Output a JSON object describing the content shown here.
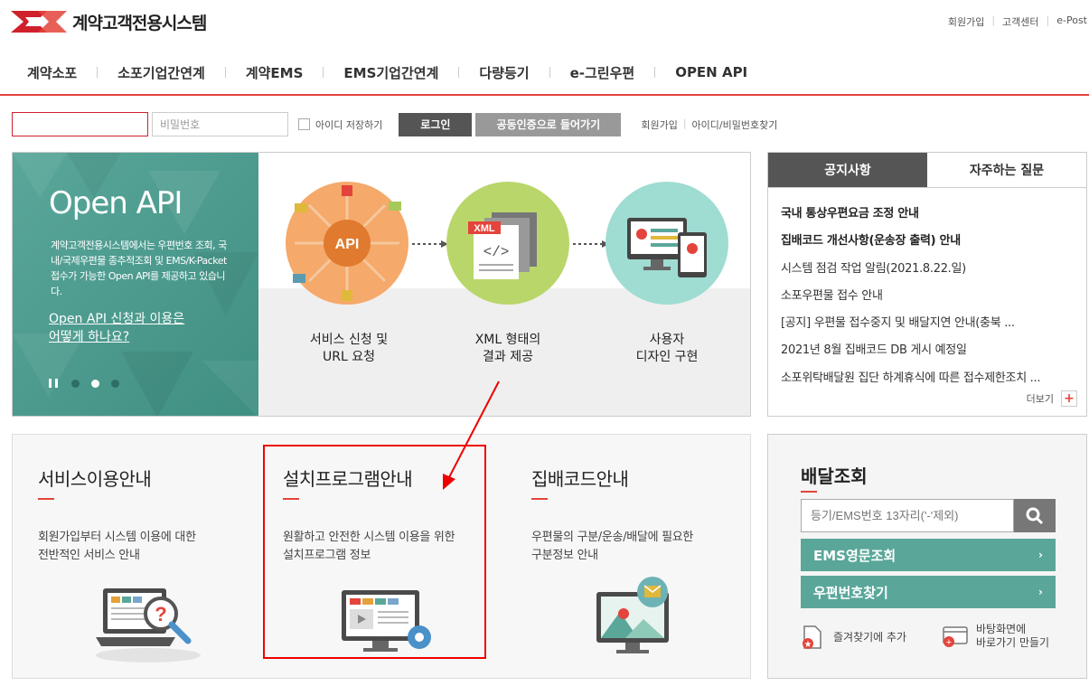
{
  "header": {
    "site_title": "계약고객전용시스템",
    "util_links": [
      "회원가입",
      "고객센터",
      "e-Post"
    ]
  },
  "gnb": {
    "items": [
      "계약소포",
      "소포기업간연계",
      "계약EMS",
      "EMS기업간연계",
      "다량등기",
      "e-그린우편",
      "OPEN API"
    ]
  },
  "login": {
    "id_value": "",
    "pw_placeholder": "비밀번호",
    "save_id_label": "아이디 저장하기",
    "login_button": "로그인",
    "cert_button": "공동인증으로 들어가기",
    "links": [
      "회원가입",
      "아이디/비밀번호찾기"
    ]
  },
  "banner": {
    "title": "Open API",
    "description": "계약고객전용시스템에서는 우편번호 조회, 국내/국제우편물 종추적조회 및 EMS/K-Packet 접수가 가능한 Open API를 제공하고 있습니다.",
    "link_text": "Open API 신청과 이용은 어떻게 하나요?",
    "steps": [
      {
        "label_line1": "서비스 신청 및",
        "label_line2": "URL 요청",
        "icon_text": "API"
      },
      {
        "label_line1": "XML 형태의",
        "label_line2": "결과 제공",
        "icon_text": "XML"
      },
      {
        "label_line1": "사용자",
        "label_line2": "디자인 구현"
      }
    ],
    "active_slide": 3
  },
  "notice": {
    "tabs": [
      "공지사항",
      "자주하는 질문"
    ],
    "items": [
      "국내 통상우편요금 조정 안내",
      "집배코드 개선사항(운송장 출력) 안내",
      "시스템 점검 작업 알림(2021.8.22.일)",
      "소포우편물 접수 안내",
      "[공지] 우편물 접수중지 및 배달지연 안내(충북 ...",
      "2021년 8월 집배코드 DB 게시 예정일",
      "소포위탁배달원 집단 하계휴식에 따른 접수제한조치 ..."
    ],
    "bold_count": 2,
    "more_label": "더보기",
    "more_icon": "+"
  },
  "guides": [
    {
      "title": "서비스이용안내",
      "desc_line1": "회원가입부터 시스템 이용에 대한",
      "desc_line2": "전반적인 서비스 안내",
      "icon": "laptop-help-icon"
    },
    {
      "title": "설치프로그램안내",
      "desc_line1": "원활하고 안전한 시스템 이용을 위한",
      "desc_line2": "설치프로그램 정보",
      "icon": "monitor-settings-icon"
    },
    {
      "title": "집배코드안내",
      "desc_line1": "우편물의 구분/운송/배달에 필요한",
      "desc_line2": "구분정보 안내",
      "icon": "map-mail-icon"
    }
  ],
  "tracking": {
    "title": "배달조회",
    "input_placeholder": "등기/EMS번호 13자리('-'제외)",
    "buttons": [
      "EMS영문조회",
      "우편번호찾기"
    ],
    "shortcuts": [
      {
        "line1": "즐겨찾기에 추가",
        "line2": ""
      },
      {
        "line1": "바탕화면에",
        "line2": "바로가기 만들기"
      }
    ]
  },
  "colors": {
    "accent": "#e3443b",
    "teal": "#5aa79a",
    "dark_button": "#555555"
  }
}
